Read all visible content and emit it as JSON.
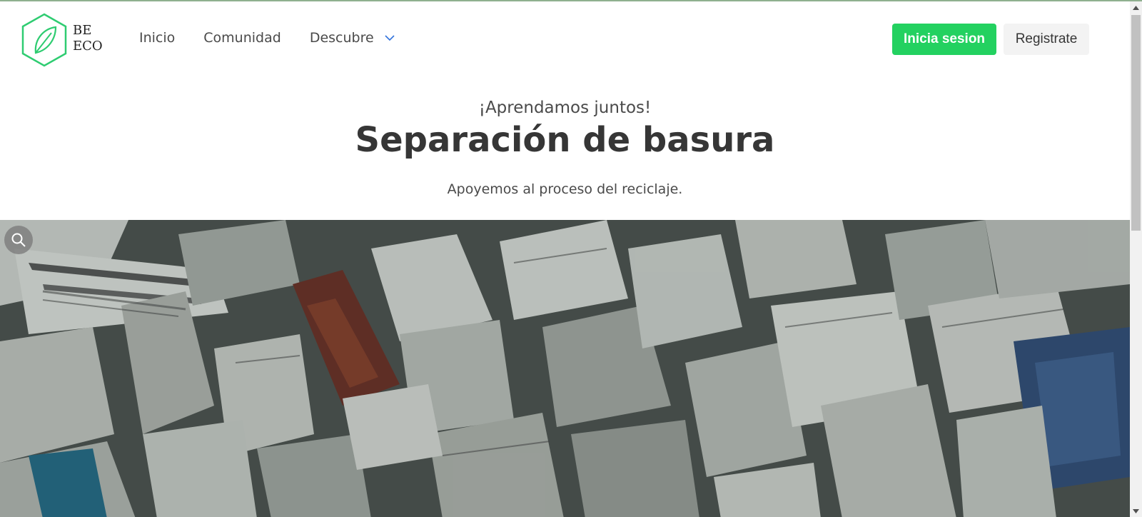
{
  "brand": {
    "line1": "BE",
    "line2": "ECO",
    "accent_color": "#2ecc71",
    "icon": "leaf-icon"
  },
  "nav": {
    "items": [
      {
        "label": "Inicio"
      },
      {
        "label": "Comunidad"
      },
      {
        "label": "Descubre",
        "icon": "chevron-down-icon"
      }
    ]
  },
  "auth": {
    "login_label": "Inicia sesion",
    "register_label": "Registrate",
    "login_color": "#23d160"
  },
  "hero": {
    "subtitle": "¡Aprendamos juntos!",
    "title": "Separación de basura",
    "description": "Apoyemos al proceso del reciclaje."
  },
  "image": {
    "icon": "search-icon"
  }
}
